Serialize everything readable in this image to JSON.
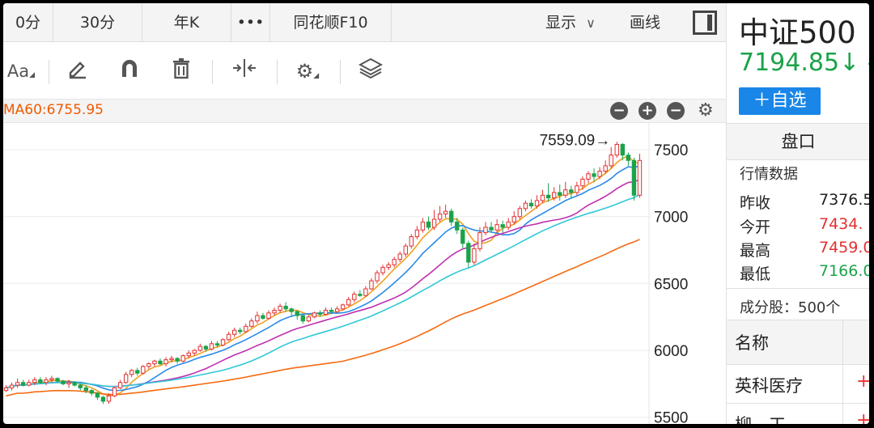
{
  "tabs": [
    {
      "label": "0分"
    },
    {
      "label": "30分"
    },
    {
      "label": "年K"
    },
    {
      "label": "•••"
    },
    {
      "label": "同花顺F10"
    }
  ],
  "header_right": {
    "display_label": "显示",
    "draw_label": "画线"
  },
  "ma_text": "MA60:6755.95",
  "chart_data": {
    "type": "candlestick",
    "y_axis_ticks": [
      "7500",
      "7000",
      "6500",
      "6000",
      "5500"
    ],
    "ylim": [
      5450,
      7700
    ],
    "high_marker": {
      "label": "7559.09→",
      "value": 7559.09
    },
    "candles": [
      [
        5700,
        5720,
        5690,
        5740
      ],
      [
        5720,
        5740,
        5700,
        5760
      ],
      [
        5740,
        5760,
        5720,
        5790
      ],
      [
        5760,
        5740,
        5730,
        5780
      ],
      [
        5740,
        5760,
        5730,
        5780
      ],
      [
        5760,
        5780,
        5740,
        5800
      ],
      [
        5780,
        5760,
        5750,
        5800
      ],
      [
        5760,
        5780,
        5740,
        5800
      ],
      [
        5780,
        5790,
        5760,
        5810
      ],
      [
        5790,
        5770,
        5760,
        5800
      ],
      [
        5770,
        5750,
        5740,
        5780
      ],
      [
        5750,
        5760,
        5720,
        5780
      ],
      [
        5760,
        5740,
        5730,
        5770
      ],
      [
        5740,
        5720,
        5700,
        5750
      ],
      [
        5720,
        5700,
        5680,
        5740
      ],
      [
        5700,
        5680,
        5660,
        5710
      ],
      [
        5680,
        5650,
        5630,
        5690
      ],
      [
        5650,
        5620,
        5600,
        5660
      ],
      [
        5620,
        5660,
        5600,
        5680
      ],
      [
        5660,
        5720,
        5650,
        5730
      ],
      [
        5720,
        5760,
        5710,
        5780
      ],
      [
        5760,
        5820,
        5750,
        5840
      ],
      [
        5820,
        5850,
        5800,
        5860
      ],
      [
        5850,
        5830,
        5810,
        5870
      ],
      [
        5830,
        5880,
        5820,
        5890
      ],
      [
        5880,
        5900,
        5860,
        5910
      ],
      [
        5900,
        5920,
        5880,
        5930
      ],
      [
        5920,
        5900,
        5890,
        5940
      ],
      [
        5900,
        5930,
        5880,
        5950
      ],
      [
        5930,
        5940,
        5910,
        5960
      ],
      [
        5940,
        5920,
        5900,
        5950
      ],
      [
        5920,
        5960,
        5910,
        5970
      ],
      [
        5960,
        5980,
        5940,
        6000
      ],
      [
        5980,
        6000,
        5960,
        6010
      ],
      [
        6000,
        6030,
        5990,
        6050
      ],
      [
        6030,
        6010,
        5990,
        6040
      ],
      [
        6010,
        6050,
        6000,
        6070
      ],
      [
        6050,
        6040,
        6020,
        6070
      ],
      [
        6040,
        6080,
        6030,
        6090
      ],
      [
        6080,
        6120,
        6070,
        6140
      ],
      [
        6120,
        6150,
        6100,
        6170
      ],
      [
        6150,
        6140,
        6120,
        6170
      ],
      [
        6140,
        6180,
        6130,
        6200
      ],
      [
        6180,
        6220,
        6170,
        6240
      ],
      [
        6220,
        6260,
        6200,
        6290
      ],
      [
        6260,
        6240,
        6230,
        6280
      ],
      [
        6240,
        6280,
        6230,
        6300
      ],
      [
        6280,
        6300,
        6260,
        6320
      ],
      [
        6300,
        6330,
        6280,
        6350
      ],
      [
        6330,
        6310,
        6290,
        6360
      ],
      [
        6310,
        6290,
        6250,
        6320
      ],
      [
        6290,
        6260,
        6230,
        6300
      ],
      [
        6260,
        6220,
        6200,
        6270
      ],
      [
        6220,
        6250,
        6210,
        6260
      ],
      [
        6250,
        6280,
        6240,
        6290
      ],
      [
        6280,
        6270,
        6250,
        6300
      ],
      [
        6270,
        6300,
        6260,
        6320
      ],
      [
        6300,
        6290,
        6270,
        6320
      ],
      [
        6290,
        6310,
        6280,
        6330
      ],
      [
        6310,
        6340,
        6300,
        6350
      ],
      [
        6340,
        6380,
        6330,
        6400
      ],
      [
        6380,
        6420,
        6360,
        6440
      ],
      [
        6420,
        6410,
        6400,
        6450
      ],
      [
        6410,
        6460,
        6400,
        6480
      ],
      [
        6460,
        6520,
        6450,
        6540
      ],
      [
        6520,
        6580,
        6500,
        6600
      ],
      [
        6580,
        6620,
        6560,
        6640
      ],
      [
        6620,
        6640,
        6600,
        6660
      ],
      [
        6640,
        6680,
        6620,
        6700
      ],
      [
        6680,
        6720,
        6660,
        6740
      ],
      [
        6720,
        6780,
        6700,
        6800
      ],
      [
        6780,
        6850,
        6760,
        6870
      ],
      [
        6850,
        6900,
        6830,
        6930
      ],
      [
        6900,
        6960,
        6880,
        6990
      ],
      [
        6960,
        6920,
        6900,
        7000
      ],
      [
        6920,
        6980,
        6900,
        7050
      ],
      [
        6980,
        7020,
        6960,
        7080
      ],
      [
        7020,
        7040,
        6990,
        7090
      ],
      [
        7040,
        6960,
        6930,
        7060
      ],
      [
        6960,
        6900,
        6870,
        6990
      ],
      [
        6900,
        6800,
        6760,
        6920
      ],
      [
        6800,
        6660,
        6620,
        6820
      ],
      [
        6660,
        6760,
        6640,
        6800
      ],
      [
        6760,
        6880,
        6740,
        6920
      ],
      [
        6880,
        6920,
        6860,
        6960
      ],
      [
        6920,
        6900,
        6880,
        6960
      ],
      [
        6900,
        6940,
        6880,
        6980
      ],
      [
        6940,
        6920,
        6880,
        6970
      ],
      [
        6920,
        6960,
        6900,
        6990
      ],
      [
        6960,
        7000,
        6940,
        7040
      ],
      [
        7000,
        7060,
        6980,
        7080
      ],
      [
        7060,
        7100,
        7040,
        7120
      ],
      [
        7100,
        7080,
        7060,
        7130
      ],
      [
        7080,
        7120,
        7060,
        7160
      ],
      [
        7120,
        7160,
        7100,
        7200
      ],
      [
        7160,
        7140,
        7110,
        7250
      ],
      [
        7140,
        7180,
        7120,
        7220
      ],
      [
        7180,
        7160,
        7120,
        7240
      ],
      [
        7160,
        7200,
        7140,
        7260
      ],
      [
        7200,
        7180,
        7140,
        7230
      ],
      [
        7180,
        7230,
        7160,
        7260
      ],
      [
        7230,
        7280,
        7200,
        7300
      ],
      [
        7280,
        7320,
        7250,
        7340
      ],
      [
        7320,
        7300,
        7260,
        7360
      ],
      [
        7300,
        7340,
        7280,
        7370
      ],
      [
        7340,
        7380,
        7320,
        7420
      ],
      [
        7380,
        7460,
        7360,
        7520
      ],
      [
        7460,
        7540,
        7440,
        7559
      ],
      [
        7540,
        7460,
        7420,
        7550
      ],
      [
        7460,
        7420,
        7380,
        7480
      ],
      [
        7420,
        7160,
        7120,
        7440
      ],
      [
        7160,
        7420,
        7140,
        7470
      ]
    ],
    "ma_lines": [
      {
        "color": "#f0a020",
        "values_from": "ma5"
      },
      {
        "color": "#2a8ae8",
        "values_from": "ma10"
      },
      {
        "color": "#c030b0",
        "values_from": "ma20"
      },
      {
        "color": "#30c8d8",
        "values_from": "ma30"
      },
      {
        "color": "#f56a10",
        "values_from": "ma60"
      }
    ]
  },
  "right_panel": {
    "name": "中证500",
    "price": "7194.85↓ -",
    "add_button": "＋自选",
    "section_title": "盘口",
    "sub_title": "行情数据",
    "quotes": [
      {
        "label": "昨收",
        "value": "7376.5",
        "color": "#222222"
      },
      {
        "label": "今开",
        "value": "7434.",
        "color": "#e33030"
      },
      {
        "label": "最高",
        "value": "7459.0",
        "color": "#e33030"
      },
      {
        "label": "最低",
        "value": "7166.0",
        "color": "#1aa34a"
      }
    ],
    "constituents": "成分股：500个",
    "table_header": "名称",
    "rows": [
      {
        "name": "英科医疗",
        "sign": "+"
      },
      {
        "name": "柳　工",
        "sign": "+"
      }
    ]
  },
  "colors": {
    "up": "#e33030",
    "down": "#1aa34a",
    "accent": "#1a86e8",
    "ma_text": "#f05a00"
  }
}
